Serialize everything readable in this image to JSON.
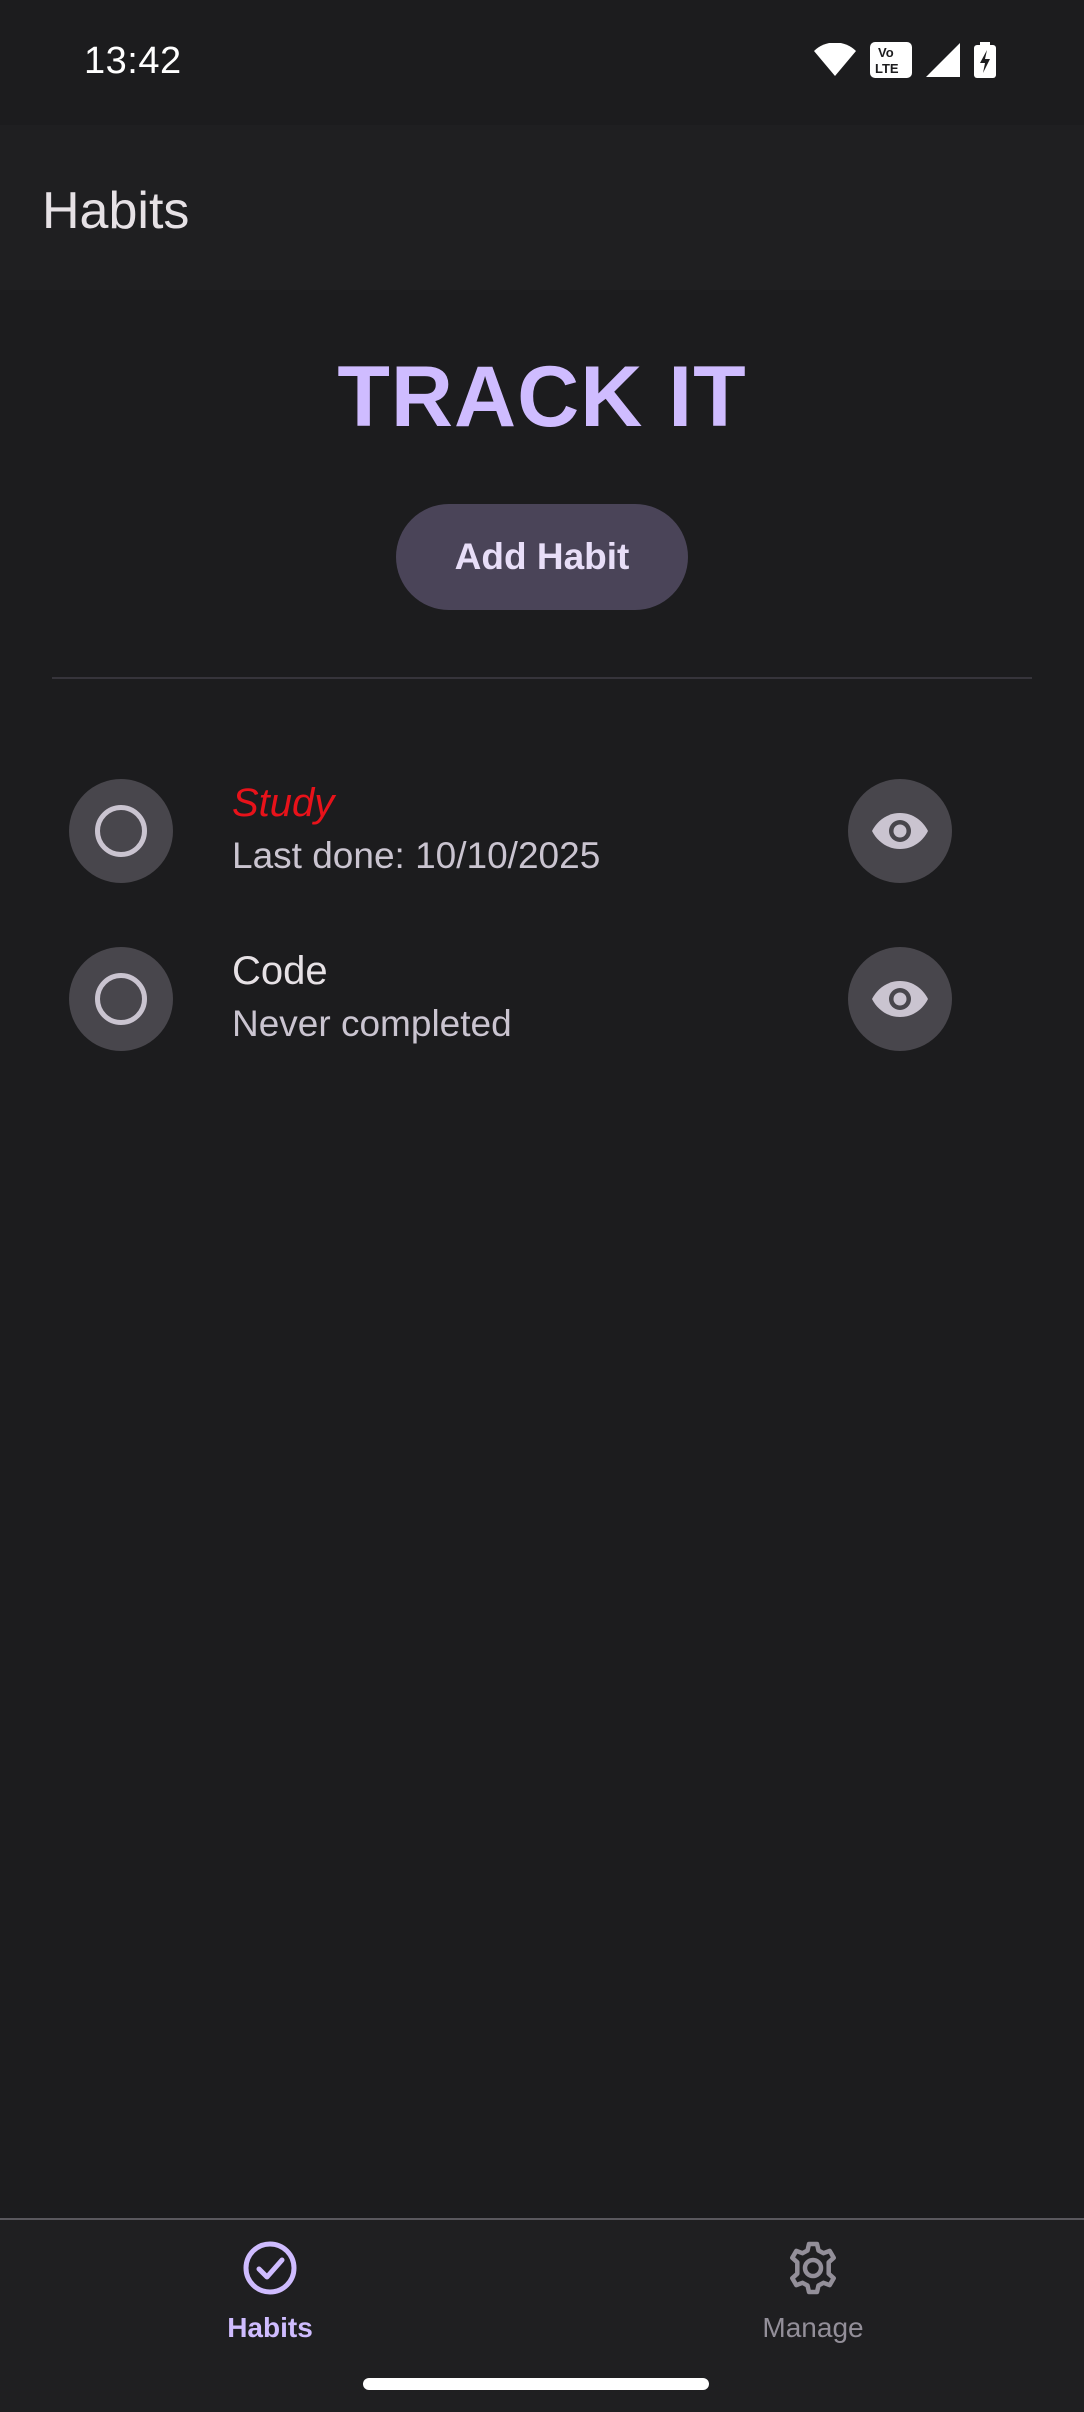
{
  "status_bar": {
    "time": "13:42",
    "volte_label_top": "Vo",
    "volte_label_bottom": "LTE",
    "icons": [
      "wifi-icon",
      "volte-icon",
      "signal-icon",
      "battery-charging-icon"
    ]
  },
  "app_bar": {
    "title": "Habits"
  },
  "main": {
    "hero_title": "TRACK IT",
    "add_button_label": "Add Habit",
    "habits": [
      {
        "name": "Study",
        "subtitle": "Last done: 10/10/2025",
        "overdue": true,
        "completed": false
      },
      {
        "name": "Code",
        "subtitle": "Never completed",
        "overdue": false,
        "completed": false
      }
    ]
  },
  "bottom_nav": {
    "items": [
      {
        "label": "Habits",
        "icon": "check-circle-icon",
        "active": true
      },
      {
        "label": "Manage",
        "icon": "gear-icon",
        "active": false
      }
    ]
  },
  "colors": {
    "background": "#1c1c1e",
    "accent": "#cfbcff",
    "overdue": "#e8121a",
    "button_bg": "#4a4458",
    "icon_button_bg": "#48464c"
  }
}
